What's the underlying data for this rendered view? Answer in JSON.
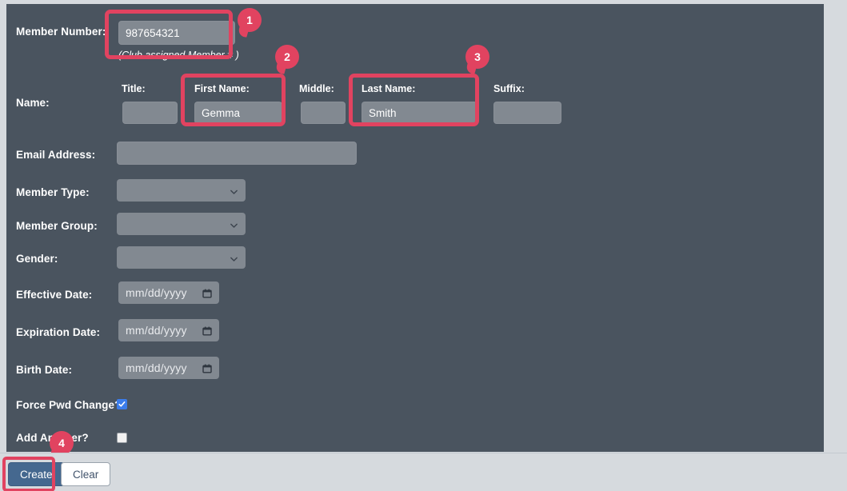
{
  "form": {
    "member_number": {
      "label": "Member Number:",
      "value": "987654321",
      "helper": "(Club assigned Member # )"
    },
    "name": {
      "label": "Name:",
      "fields": [
        {
          "label": "Title:",
          "value": ""
        },
        {
          "label": "First Name:",
          "value": "Gemma"
        },
        {
          "label": "Middle:",
          "value": ""
        },
        {
          "label": "Last Name:",
          "value": "Smith"
        },
        {
          "label": "Suffix:",
          "value": ""
        }
      ]
    },
    "email": {
      "label": "Email Address:",
      "value": ""
    },
    "member_type": {
      "label": "Member Type:",
      "value": ""
    },
    "member_group": {
      "label": "Member Group:",
      "value": ""
    },
    "gender": {
      "label": "Gender:",
      "value": ""
    },
    "effective_date": {
      "label": "Effective Date:",
      "value": "mm/dd/yyyy"
    },
    "expiration_date": {
      "label": "Expiration Date:",
      "value": "mm/dd/yyyy"
    },
    "birth_date": {
      "label": "Birth Date:",
      "value": "mm/dd/yyyy"
    },
    "force_pwd_change": {
      "label": "Force Pwd Change?",
      "checked": "checked"
    },
    "add_another": {
      "label": "Add Another?",
      "checked": ""
    }
  },
  "footer": {
    "create_label": "Create",
    "clear_label": "Clear"
  },
  "annotations": {
    "badges": [
      {
        "number": "1"
      },
      {
        "number": "2"
      },
      {
        "number": "3"
      },
      {
        "number": "4"
      }
    ],
    "accent_color": "#e14360"
  },
  "colors": {
    "panel_bg": "#4a545f",
    "input_bg": "#828991",
    "footer_bg": "#d6dade",
    "create_btn": "#45688f",
    "checkbox_on": "#3b7deb",
    "highlight": "#e14360"
  }
}
